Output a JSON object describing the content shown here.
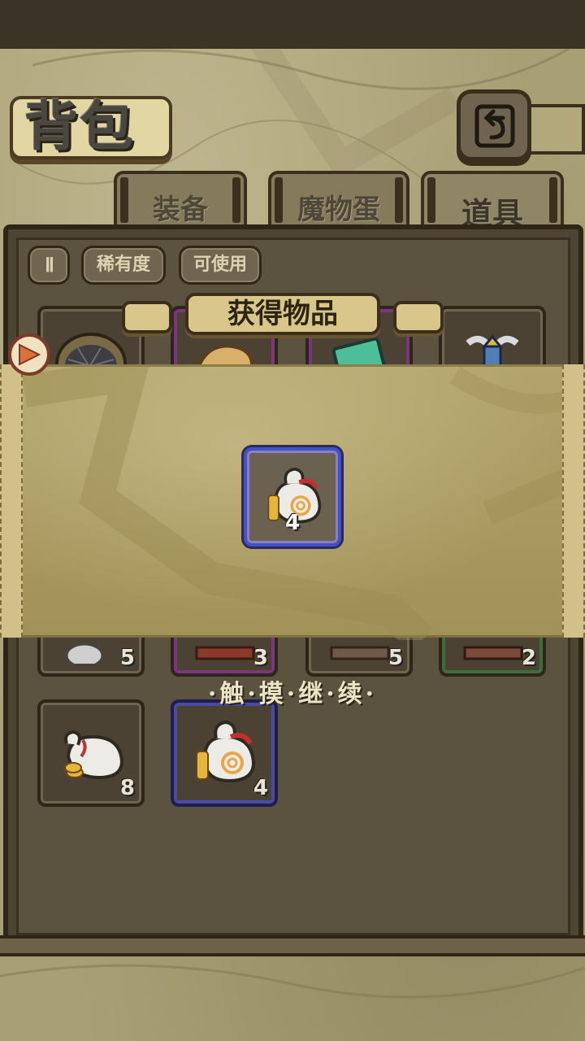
{
  "header": {
    "title": "背包"
  },
  "tabs": [
    {
      "label": "装备",
      "active": false
    },
    {
      "label": "魔物蛋",
      "active": false
    },
    {
      "label": "道具",
      "active": true
    }
  ],
  "filters": {
    "sort_label": "Ⅱ",
    "rarity_label": "稀有度",
    "usable_label": "可使用"
  },
  "inventory": [
    {
      "icon": "net-icon",
      "count": ""
    },
    {
      "icon": "bread-icon",
      "count": ""
    },
    {
      "icon": "book-icon",
      "count": ""
    },
    {
      "icon": "winged-tower-icon",
      "count": ""
    },
    {
      "icon": "speech-bubble-icon",
      "count": "5"
    },
    {
      "icon": "chest-icon",
      "count": "3"
    },
    {
      "icon": "chest-icon",
      "count": "5"
    },
    {
      "icon": "chest-icon",
      "count": "2"
    },
    {
      "icon": "coin-bag-icon",
      "count": "8"
    },
    {
      "icon": "coin-bag-icon",
      "count": "4"
    }
  ],
  "popup": {
    "title": "获得物品",
    "reward": {
      "icon": "coin-bag-icon",
      "count": "4",
      "rarity_color": "#4450c8"
    },
    "continue_text": "·触·摸·继·续·"
  },
  "colors": {
    "parchment": "#a99f75",
    "board": "#4e4434",
    "blue_rarity": "#4450c8",
    "purple_rarity": "#7a3680",
    "green_rarity": "#3f6d3a"
  }
}
